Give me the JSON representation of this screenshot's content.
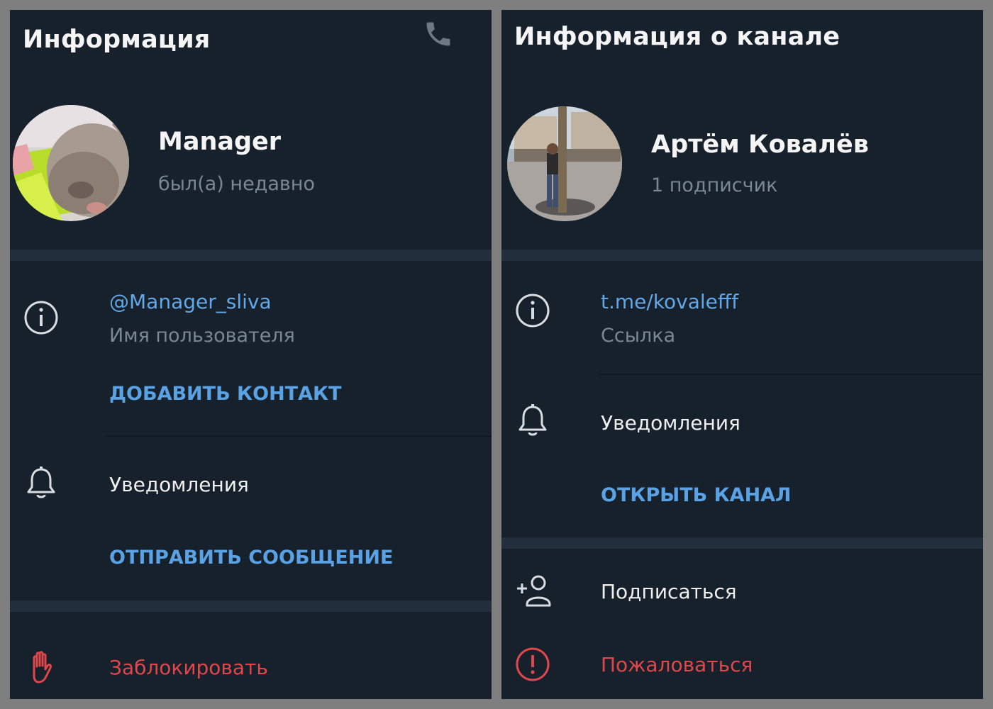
{
  "user_panel": {
    "title": "Информация",
    "name": "Manager",
    "status": "был(а) недавно",
    "username": "@Manager_sliva",
    "username_caption": "Имя пользователя",
    "add_contact": "ДОБАВИТЬ КОНТАКТ",
    "notifications": "Уведомления",
    "send_message": "ОТПРАВИТЬ СООБЩЕНИЕ",
    "block": "Заблокировать"
  },
  "channel_panel": {
    "title": "Информация о канале",
    "name": "Артём Ковалёв",
    "subscribers": "1 подписчик",
    "link": "t.me/kovalefff",
    "link_caption": "Ссылка",
    "notifications": "Уведомления",
    "open_channel": "ОТКРЫТЬ КАНАЛ",
    "subscribe": "Подписаться",
    "report": "Пожаловаться"
  },
  "icons": {
    "call": "phone-icon",
    "info": "info-icon",
    "notifications": "bell-icon",
    "block": "hand-icon",
    "subscribe": "add-user-icon",
    "report": "exclamation-icon"
  },
  "colors": {
    "panel_bg": "#17212b",
    "separator": "#232e3c",
    "accent": "#5aa2e4",
    "danger": "#e0474c",
    "muted": "#7b8893"
  }
}
